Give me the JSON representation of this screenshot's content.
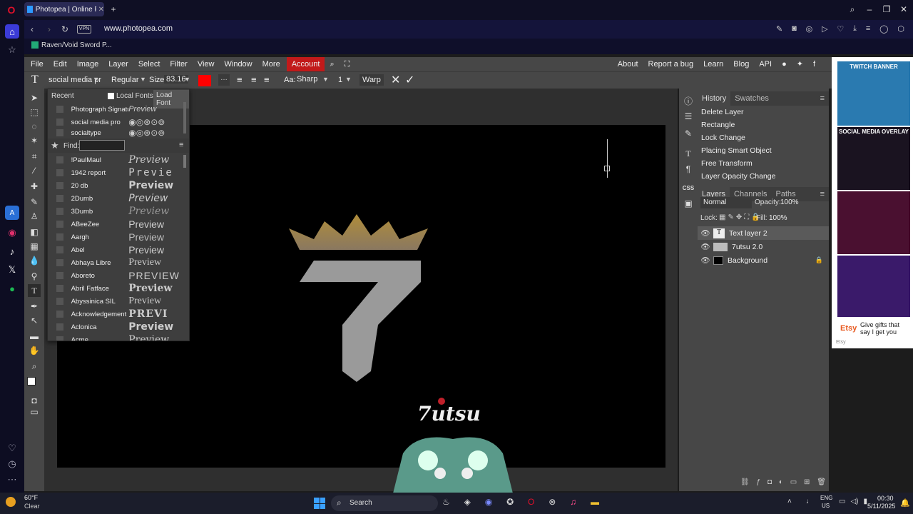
{
  "browser": {
    "tab_title": "Photopea | Online Photo",
    "url": "www.photopea.com",
    "vpn": "VPN",
    "bookmark": "Raven/Void Sword P..."
  },
  "menu": [
    "File",
    "Edit",
    "Image",
    "Layer",
    "Select",
    "Filter",
    "View",
    "Window",
    "More"
  ],
  "account": "Account",
  "menu_right": [
    "About",
    "Report a bug",
    "Learn",
    "Blog",
    "API"
  ],
  "options": {
    "font": "social media pr",
    "style": "Regular",
    "size_label": "Size:",
    "size": "83.16",
    "text_color": "#ff0000",
    "aa_label": "Aa:",
    "aa": "Sharp",
    "leading": "1",
    "warp": "Warp"
  },
  "fontpanel": {
    "recent_label": "Recent",
    "local_fonts": "Local Fonts",
    "load_font": "Load Font",
    "find_label": "Find:",
    "find_value": "",
    "recent": [
      {
        "name": "Photograph Signatu",
        "preview": "Preview"
      },
      {
        "name": "social media pro",
        "preview": "◉◎⊛⊙⊚"
      },
      {
        "name": "socialtype",
        "preview": "◉◎⊛⊙⊚"
      }
    ],
    "fonts": [
      {
        "name": "!PaulMaul",
        "preview": "Preview"
      },
      {
        "name": "1942 report",
        "preview": "Previe"
      },
      {
        "name": "20 db",
        "preview": "Preview"
      },
      {
        "name": "2Dumb",
        "preview": "Preview"
      },
      {
        "name": "3Dumb",
        "preview": "Preview"
      },
      {
        "name": "ABeeZee",
        "preview": "Preview"
      },
      {
        "name": "Aargh",
        "preview": "Preview"
      },
      {
        "name": "Abel",
        "preview": "Preview"
      },
      {
        "name": "Abhaya Libre",
        "preview": "Preview"
      },
      {
        "name": "Aboreto",
        "preview": "PREVIEW"
      },
      {
        "name": "Abril Fatface",
        "preview": "Preview"
      },
      {
        "name": "Abyssinica SIL",
        "preview": "Preview"
      },
      {
        "name": "Acknowledgement",
        "preview": "PREVI"
      },
      {
        "name": "Aclonica",
        "preview": "Preview"
      },
      {
        "name": "Acme",
        "preview": "Preview"
      }
    ]
  },
  "history": {
    "tabs": [
      "History",
      "Swatches"
    ],
    "items": [
      "Delete Layer",
      "Rectangle",
      "Lock Change",
      "Placing Smart Object",
      "Free Transform",
      "Layer Opacity Change"
    ]
  },
  "layers": {
    "tabs": [
      "Layers",
      "Channels",
      "Paths"
    ],
    "blend": "Normal",
    "opacity_label": "Opacity:",
    "opacity": "100%",
    "lock_label": "Lock:",
    "fill_label": "Fill:",
    "fill": "100%",
    "items": [
      "Text layer 2",
      "7utsu 2.0",
      "Background"
    ]
  },
  "canvas": {
    "logo_text": "7utsu"
  },
  "ad": {
    "banner": "TWITCH BANNER",
    "overlay": "SOCIAL MEDIA OVERLAY",
    "etsy": "Etsy",
    "gift": "Give gifts that say I get you",
    "etsy_small": "Etsy"
  },
  "taskbar": {
    "weather_temp": "60°F",
    "weather_desc": "Clear",
    "search": "Search",
    "lang1": "ENG",
    "lang2": "US",
    "time": "00:30",
    "date": "5/11/2025"
  }
}
